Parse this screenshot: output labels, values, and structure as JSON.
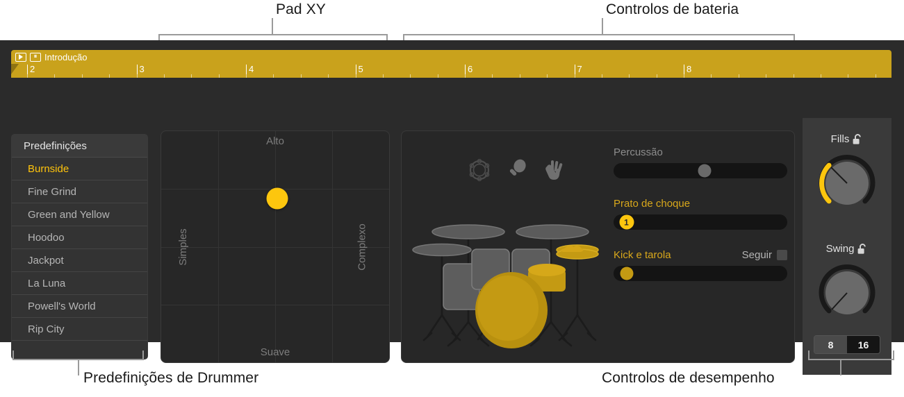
{
  "callouts": {
    "pad_xy": "Pad XY",
    "drum_controls": "Controlos de bateria",
    "drummer_presets": "Predefinições de Drummer",
    "performance_controls": "Controlos de desempenho"
  },
  "region": {
    "name": "Introdução",
    "play_icon": "play-icon",
    "region_icon": "drummer-region-icon",
    "bars": [
      "2",
      "3",
      "4",
      "5",
      "6",
      "7",
      "8"
    ]
  },
  "presets": {
    "header": "Predefinições",
    "items": [
      {
        "label": "Burnside",
        "selected": true
      },
      {
        "label": "Fine Grind",
        "selected": false
      },
      {
        "label": "Green and Yellow",
        "selected": false
      },
      {
        "label": "Hoodoo",
        "selected": false
      },
      {
        "label": "Jackpot",
        "selected": false
      },
      {
        "label": "La Luna",
        "selected": false
      },
      {
        "label": "Powell's World",
        "selected": false
      },
      {
        "label": "Rip City",
        "selected": false
      }
    ]
  },
  "xy_pad": {
    "top_label": "Alto",
    "bottom_label": "Suave",
    "left_label": "Simples",
    "right_label": "Complexo",
    "puck_x_pct": 51,
    "puck_y_pct": 29,
    "puck_color": "#fdc60e"
  },
  "drum_controls": {
    "percussion_icons": [
      "tambourine-icon",
      "shaker-icon",
      "clap-icon"
    ],
    "sliders": [
      {
        "label": "Percussão",
        "value_pct": 48,
        "active": false,
        "badge": null,
        "thumb_style": "grey",
        "follow": null
      },
      {
        "label": "Prato de choque",
        "value_pct": 3,
        "active": true,
        "badge": "1",
        "thumb_style": "bright",
        "follow": null
      },
      {
        "label": "Kick e tarola",
        "value_pct": 3,
        "active": true,
        "badge": null,
        "thumb_style": "gold",
        "follow": "Seguir"
      }
    ]
  },
  "performance": {
    "fills": {
      "label": "Fills",
      "lock_icon": "unlocked-padlock-icon",
      "value_pct": 22,
      "arc_color": "#fdc60e"
    },
    "swing": {
      "label": "Swing",
      "lock_icon": "unlocked-padlock-icon",
      "value_pct": 4,
      "arc_color": "#333333"
    },
    "division": {
      "options": [
        "8",
        "16"
      ],
      "selected": "16"
    }
  },
  "colors": {
    "accent": "#fdc60e",
    "region": "#c9a21c",
    "panel_bg": "#272727",
    "window_bg": "#2b2b2b"
  }
}
